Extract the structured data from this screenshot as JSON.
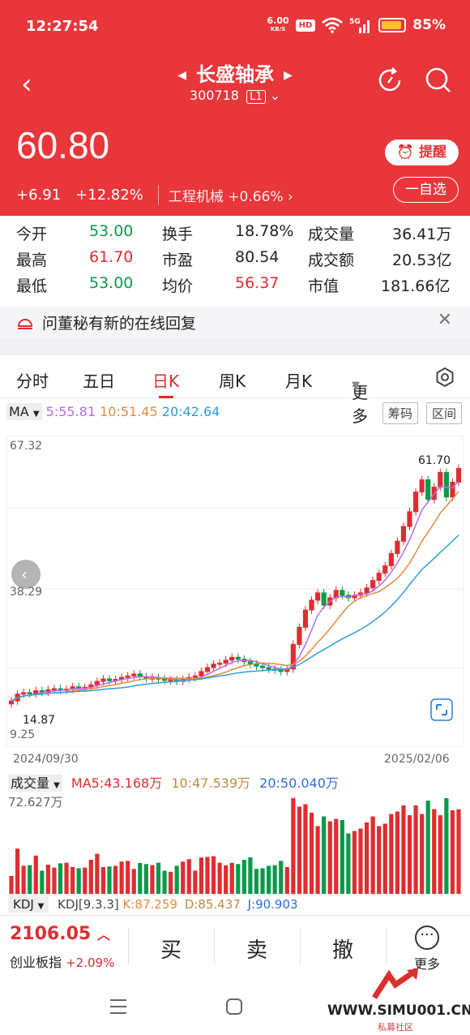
{
  "status_bar": {
    "time": "12:27:54",
    "speed": "6.00",
    "speed_unit": "KB/S",
    "hd": "HD",
    "net": "5G",
    "battery": "85%"
  },
  "header": {
    "stock_name": "长盛轴承",
    "code": "300718",
    "level": "L1"
  },
  "quote": {
    "price": "60.80",
    "change": "+6.91",
    "change_pct": "+12.82%",
    "sector": "工程机械",
    "sector_pct": "+0.66%",
    "alert_label": "提醒",
    "watchlist_label": "一自选"
  },
  "stats": [
    {
      "l1": "今开",
      "v1": "53.00",
      "l2": "换手",
      "v2": "18.78%",
      "l3": "成交量",
      "v3": "36.41万"
    },
    {
      "l1": "最高",
      "v1": "61.70",
      "l2": "市盈",
      "v2": "80.54",
      "l3": "成交额",
      "v3": "20.53亿"
    },
    {
      "l1": "最低",
      "v1": "53.00",
      "l2": "均价",
      "v2": "56.37",
      "l3": "市值",
      "v3": "181.66亿"
    }
  ],
  "notice": {
    "text": "问董秘有新的在线回复"
  },
  "tabs": [
    "分时",
    "五日",
    "日K",
    "周K",
    "月K",
    "更多"
  ],
  "ma": {
    "label": "MA",
    "ma5": "5:55.81",
    "ma10": "10:51.45",
    "ma20": "20:42.64"
  },
  "chart_buttons": {
    "chips": "筹码",
    "range": "区间"
  },
  "chart_labels": {
    "ymax": "67.32",
    "ymid": "38.29",
    "ymin": "9.25",
    "date_start": "2024/09/30",
    "date_end": "2025/02/06",
    "low_mark": "14.87",
    "high_mark": "61.70"
  },
  "volume": {
    "label": "成交量",
    "ma5": "MA5:43.168万",
    "ma10": "10:47.539万",
    "ma20": "20:50.040万",
    "max": "72.627万"
  },
  "kdj": {
    "label": "KDJ",
    "params": "KDJ[9.3.3]",
    "k": "K:87.259",
    "d": "D:85.437",
    "j": "J:90.903"
  },
  "bottom": {
    "index_value": "2106.05",
    "index_name": "创业板指",
    "index_pct": "+2.09%",
    "buy": "买",
    "sell": "卖",
    "cancel": "撤",
    "more": "更多"
  },
  "watermark": {
    "site": "WWW.SIMU001.CN",
    "sub": "私募社区"
  },
  "colors": {
    "up": "#e02d30",
    "down": "#0a9a4a",
    "brand": "#e8363a",
    "ma5": "#b56ee6",
    "ma10": "#e58a3b",
    "ma20": "#2e9fd8"
  },
  "chart_data": {
    "type": "candlestick",
    "x_range": [
      "2024/09/30",
      "2025/02/06"
    ],
    "ylim": [
      9.25,
      67.32
    ],
    "marks": {
      "low": 14.87,
      "high": 61.7
    },
    "close_trend": [
      13.5,
      14.9,
      15.2,
      15.0,
      15.6,
      15.3,
      15.8,
      16.0,
      15.7,
      15.9,
      16.4,
      16.1,
      16.3,
      16.8,
      17.5,
      18.0,
      17.6,
      17.9,
      18.3,
      18.6,
      19.0,
      18.4,
      18.0,
      18.2,
      18.0,
      17.7,
      17.8,
      17.5,
      17.9,
      18.3,
      18.6,
      19.5,
      20.3,
      21.0,
      21.2,
      21.8,
      22.4,
      22.0,
      21.5,
      21.0,
      20.6,
      20.3,
      20.0,
      19.8,
      19.5,
      20.0,
      25.0,
      28.5,
      32.0,
      34.0,
      35.5,
      33.0,
      34.5,
      36.0,
      35.0,
      34.5,
      35.0,
      35.5,
      36.5,
      38.0,
      39.5,
      41.0,
      43.5,
      46.0,
      49.0,
      52.0,
      56.0,
      58.5,
      54.5,
      57.0,
      60.0,
      55.0,
      58.0,
      60.8
    ]
  }
}
